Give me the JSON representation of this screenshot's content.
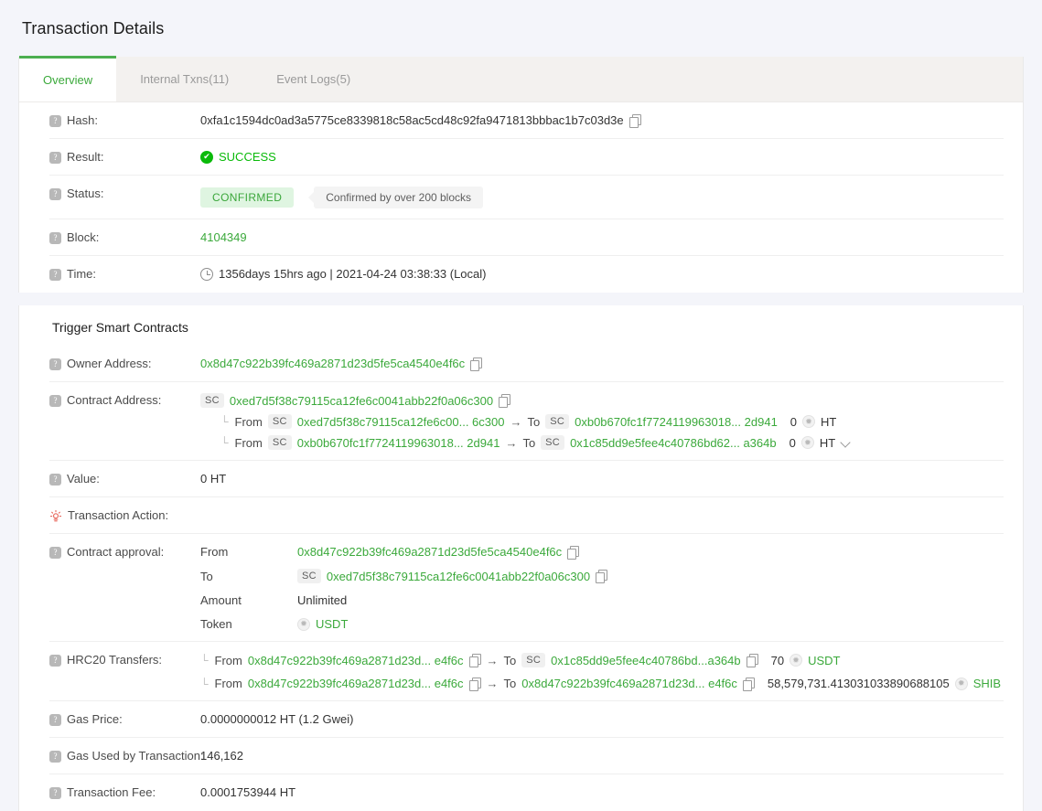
{
  "page": {
    "title": "Transaction Details",
    "accent_green": "#3ba93b",
    "success_green": "#0aba0a",
    "bg": "#f4f5fa"
  },
  "tabs": [
    {
      "label": "Overview",
      "active": true
    },
    {
      "label": "Internal Txns(11)",
      "active": false
    },
    {
      "label": "Event Logs(5)",
      "active": false
    }
  ],
  "overview": {
    "hash": {
      "label": "Hash:",
      "value": "0xfa1c1594dc0ad3a5775ce8339818c58ac5cd48c92fa9471813bbbac1b7c03d3e"
    },
    "result": {
      "label": "Result:",
      "value": "SUCCESS"
    },
    "status": {
      "label": "Status:",
      "pill": "CONFIRMED",
      "tooltip": "Confirmed by over 200 blocks"
    },
    "block": {
      "label": "Block:",
      "value": "4104349"
    },
    "time": {
      "label": "Time:",
      "value": "1356days 15hrs ago | 2021-04-24 03:38:33 (Local)"
    }
  },
  "contract_section": {
    "title": "Trigger Smart Contracts",
    "owner": {
      "label": "Owner Address:",
      "value": "0x8d47c922b39fc469a2871d23d5fe5ca4540e4f6c"
    },
    "contract": {
      "label": "Contract Address:",
      "badge": "SC",
      "value": "0xed7d5f38c79115ca12fe6c0041abb22f0a06c300"
    },
    "internal_transfers": [
      {
        "from_word": "From",
        "from_badge": "SC",
        "from_addr": "0xed7d5f38c79115ca12fe6c00... 6c300",
        "to_word": "To",
        "to_badge": "SC",
        "to_addr": "0xb0b670fc1f7724119963018... 2d941",
        "amount": "0",
        "token": "HT"
      },
      {
        "from_word": "From",
        "from_badge": "SC",
        "from_addr": "0xb0b670fc1f7724119963018... 2d941",
        "to_word": "To",
        "to_badge": "SC",
        "to_addr": "0x1c85dd9e5fee4c40786bd62... a364b",
        "amount": "0",
        "token": "HT"
      }
    ],
    "value": {
      "label": "Value:",
      "value": "0 HT"
    },
    "transaction_action": {
      "label": "Transaction Action:",
      "value": ""
    },
    "contract_approval": {
      "label": "Contract approval:",
      "from": {
        "key": "From",
        "value": "0x8d47c922b39fc469a2871d23d5fe5ca4540e4f6c"
      },
      "to": {
        "key": "To",
        "badge": "SC",
        "value": "0xed7d5f38c79115ca12fe6c0041abb22f0a06c300"
      },
      "amount": {
        "key": "Amount",
        "value": "Unlimited"
      },
      "token": {
        "key": "Token",
        "value": "USDT"
      }
    },
    "hrc20_transfers": {
      "label": "HRC20 Transfers:",
      "rows": [
        {
          "from_word": "From",
          "from_addr": "0x8d47c922b39fc469a2871d23d... e4f6c",
          "to_word": "To",
          "to_badge": "SC",
          "to_addr": "0x1c85dd9e5fee4c40786bd...a364b",
          "amount": "70",
          "token": "USDT"
        },
        {
          "from_word": "From",
          "from_addr": "0x8d47c922b39fc469a2871d23d... e4f6c",
          "to_word": "To",
          "to_badge": "",
          "to_addr": "0x8d47c922b39fc469a2871d23d... e4f6c",
          "amount": "58,579,731.413031033890688105",
          "token": "SHIB"
        }
      ]
    },
    "gas_price": {
      "label": "Gas Price:",
      "value": "0.0000000012 HT (1.2 Gwei)"
    },
    "gas_used": {
      "label": "Gas Used by Transaction:",
      "value": "146,162"
    },
    "fee": {
      "label": "Transaction Fee:",
      "value": "0.0001753944 HT"
    }
  },
  "icons": {
    "help": "?",
    "check": "✔",
    "arrow": "→",
    "corner": "└",
    "token_glyph": "✹"
  }
}
